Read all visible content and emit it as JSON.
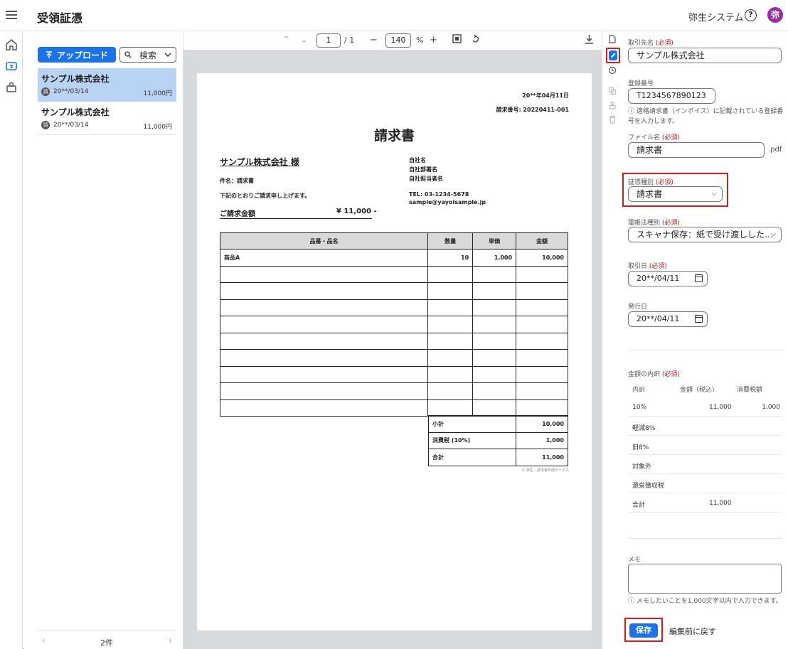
{
  "header": {
    "title": "受領証憑",
    "company": "弥生システム",
    "help": "?",
    "avatar": "弥"
  },
  "list": {
    "upload_label": "アップロード",
    "search_label": "検索",
    "items": [
      {
        "name": "サンプル株式会社",
        "badge": "請",
        "date": "20**/03/14",
        "amount": "11,000円"
      },
      {
        "name": "サンプル株式会社",
        "badge": "請",
        "date": "20**/03/14",
        "amount": "11,000円"
      }
    ],
    "count": "2件"
  },
  "viewer": {
    "page_current": "1",
    "page_total": "/ 1",
    "zoom": "140",
    "zoom_unit": "%"
  },
  "doc": {
    "date": "20**年04月11日",
    "number": "請求番号: 20220411-001",
    "title": "請求書",
    "client": "サンプル株式会社 様",
    "subject": "件名：請求書",
    "greeting": "下記のとおりご請求申し上げます。",
    "total_label": "ご請求金額",
    "total_value": "¥ 11,000 -",
    "sender": [
      "自社名",
      "自社部署名",
      "自社担当者名"
    ],
    "tel": "TEL: 03-1234-5678",
    "email": "sample@yayoisample.jp",
    "columns": [
      "品番・品名",
      "数量",
      "単価",
      "金額"
    ],
    "rows": [
      [
        "商品A",
        "10",
        "1,000",
        "10,000"
      ]
    ],
    "summary": [
      [
        "小計",
        "10,000"
      ],
      [
        "消費税 (10%)",
        "1,000"
      ],
      [
        "合計",
        "11,000"
      ]
    ],
    "footer": "© 弥生 - 請求書作成サービス"
  },
  "form": {
    "partner_label": "取引先名",
    "required": "(必須)",
    "partner_value": "サンプル株式会社",
    "reg_label": "登録番号",
    "reg_value": "T1234567890123",
    "reg_note": "適格請求書（インボイス）に記載されている登録番号を入力します。",
    "file_label": "ファイル名",
    "file_value": "請求書",
    "file_ext": ".pdf",
    "doc_type_label": "証憑種別",
    "doc_type_value": "請求書",
    "ledger_label": "電帳法種別",
    "ledger_value": "スキャナ保存：紙で受け渡しした…",
    "trade_date_label": "取引日",
    "trade_date_value": "20**/04/11",
    "issue_date_label": "発行日",
    "issue_date_value": "20**/04/11",
    "breakdown_label": "金額の内訳",
    "breakdown_headers": [
      "内訳",
      "金額（税込）",
      "消費税額"
    ],
    "breakdown_rows": [
      [
        "10%",
        "11,000",
        "1,000"
      ],
      [
        "軽減8%",
        "",
        ""
      ],
      [
        "旧8%",
        "",
        ""
      ],
      [
        "対象外",
        "",
        ""
      ],
      [
        "源泉徴収税",
        "",
        ""
      ],
      [
        "合計",
        "11,000",
        ""
      ]
    ],
    "memo_label": "メモ",
    "memo_note": "メモしたいことを1,000文字以内で入力できます。",
    "save_label": "保存",
    "revert_label": "編集前に戻す"
  }
}
